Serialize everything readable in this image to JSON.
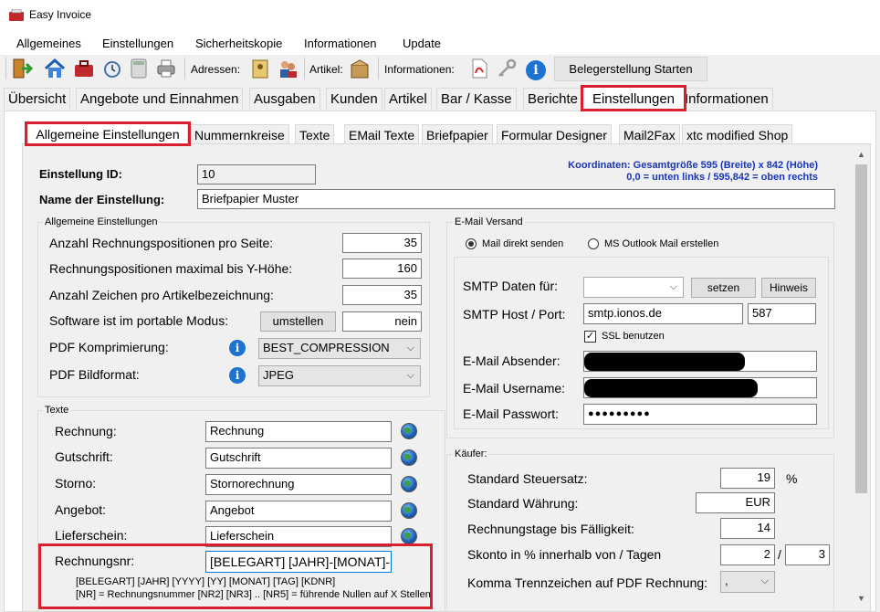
{
  "window": {
    "title": "Easy Invoice"
  },
  "menu": [
    "Allgemeines",
    "Einstellungen",
    "Sicherheitskopie",
    "Informationen",
    "Update"
  ],
  "toolbar": {
    "adressen_label": "Adressen:",
    "artikel_label": "Artikel:",
    "informationen_label": "Informationen:",
    "start_button": "Belegerstellung Starten"
  },
  "main_tabs": [
    "Übersicht",
    "Angebote und Einnahmen",
    "Ausgaben",
    "Kunden",
    "Artikel",
    "Bar / Kasse",
    "Berichte",
    "Einstellungen",
    "Informationen"
  ],
  "sub_tabs": [
    "Allgemeine Einstellungen",
    "Nummernkreise",
    "Texte",
    "EMail Texte",
    "Briefpapier",
    "Formular Designer",
    "Mail2Fax",
    "xtc modified Shop"
  ],
  "header": {
    "id_label": "Einstellung ID:",
    "id_value": "10",
    "name_label": "Name der Einstellung:",
    "name_value": "Briefpapier Muster",
    "coords_line1": "Koordinaten: Gesamtgröße 595 (Breite) x 842 (Höhe)",
    "coords_line2": "0,0 = unten links / 595,842 = oben rechts"
  },
  "allgemein": {
    "title": "Allgemeine Einstellungen",
    "rows": [
      {
        "label": "Anzahl Rechnungspositionen pro Seite:",
        "value": "35"
      },
      {
        "label": "Rechnungspositionen maximal bis Y-Höhe:",
        "value": "160"
      },
      {
        "label": "Anzahl Zeichen pro Artikelbezeichnung:",
        "value": "35"
      }
    ],
    "portable_label": "Software ist im portable Modus:",
    "portable_button": "umstellen",
    "portable_value": "nein",
    "pdf_comp_label": "PDF Komprimierung:",
    "pdf_comp_value": "BEST_COMPRESSION",
    "pdf_format_label": "PDF Bildformat:",
    "pdf_format_value": "JPEG"
  },
  "texte": {
    "title": "Texte",
    "rows": [
      {
        "label": "Rechnung:",
        "value": "Rechnung"
      },
      {
        "label": "Gutschrift:",
        "value": "Gutschrift"
      },
      {
        "label": "Storno:",
        "value": "Stornorechnung"
      },
      {
        "label": "Angebot:",
        "value": "Angebot"
      },
      {
        "label": "Lieferschein:",
        "value": "Lieferschein"
      }
    ],
    "nr_label": "Rechnungsnr:",
    "nr_value": "[BELEGART] [JAHR]-[MONAT]-[N",
    "hint1": "[BELEGART] [JAHR] [YYYY] [YY] [MONAT] [TAG] [KDNR]",
    "hint2": "[NR] = Rechnungsnummer [NR2] [NR3] .. [NR5] = führende Nullen auf X Stellen"
  },
  "email": {
    "title": "E-Mail Versand",
    "radio1": "Mail direkt senden",
    "radio2": "MS Outlook Mail erstellen",
    "smtp_for_label": "SMTP Daten für:",
    "set_button": "setzen",
    "hint_button": "Hinweis",
    "host_label": "SMTP Host / Port:",
    "host_value": "smtp.ionos.de",
    "port_value": "587",
    "ssl_label": "SSL benutzen",
    "sender_label": "E-Mail Absender:",
    "username_label": "E-Mail Username:",
    "password_label": "E-Mail Passwort:",
    "password_value": "●●●●●●●●●"
  },
  "kaeufer": {
    "title": "Käufer:",
    "tax_label": "Standard Steuersatz:",
    "tax_value": "19",
    "tax_unit": "%",
    "currency_label": "Standard Währung:",
    "currency_value": "EUR",
    "days_label": "Rechnungstage bis Fälligkeit:",
    "days_value": "14",
    "skonto_label": "Skonto in % innerhalb von / Tagen",
    "skonto_pct": "2",
    "skonto_sep": "/",
    "skonto_days": "3",
    "comma_label": "Komma Trennzeichen auf PDF Rechnung:",
    "comma_value": ","
  },
  "icons": [
    "app-icon",
    "exit-icon",
    "home-icon",
    "briefcase-icon",
    "alarm-clock-icon",
    "calculator-icon",
    "printer-icon",
    "address-book-icon",
    "contacts-icon",
    "package-icon",
    "pdf-icon",
    "key-icon",
    "info-icon",
    "globe-icon"
  ],
  "colors": {
    "highlight": "#d9202f",
    "note_blue": "#1a35b8",
    "info_blue": "#1e73d2"
  }
}
